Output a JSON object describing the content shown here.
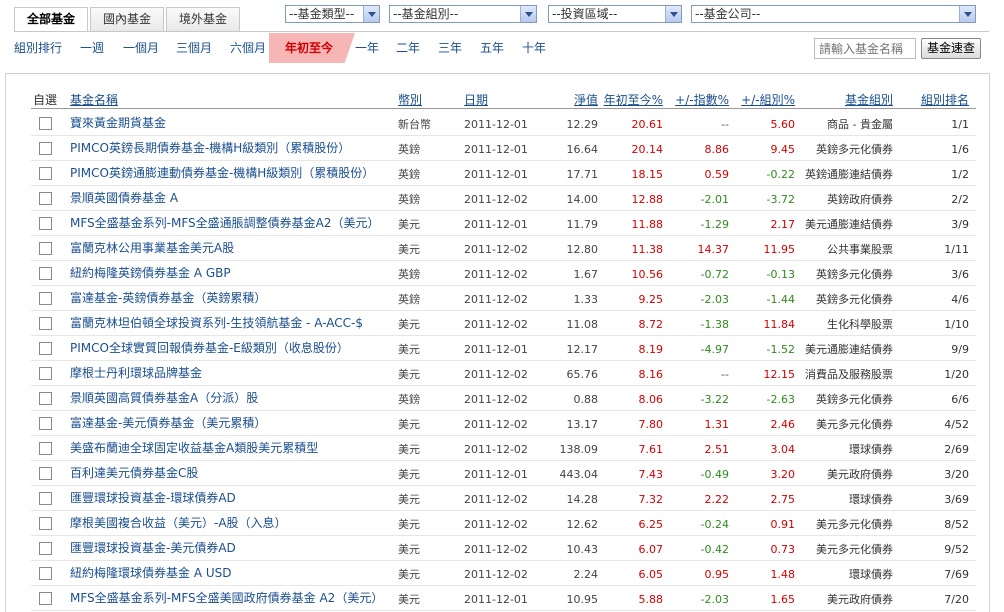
{
  "tabs": [
    "全部基金",
    "國內基金",
    "境外基金"
  ],
  "selects": {
    "type": "--基金類型--",
    "group": "--基金組別--",
    "region": "--投資區域--",
    "company": "--基金公司--"
  },
  "periods": [
    "組別排行",
    "一週",
    "一個月",
    "三個月",
    "六個月",
    "年初至今",
    "一年",
    "二年",
    "三年",
    "五年",
    "十年"
  ],
  "active_period": "年初至今",
  "search": {
    "placeholder": "請輸入基金名稱",
    "button": "基金速查"
  },
  "table": {
    "headers": {
      "select": "自選",
      "name": "基金名稱",
      "currency": "幣別",
      "date": "日期",
      "nav": "淨值",
      "ytd": "年初至今%",
      "vs_index": "+/-指數%",
      "vs_group": "+/-組別%",
      "group": "基金組別",
      "rank": "組別排名"
    },
    "rows": [
      {
        "name": "寶來黃金期貨基金",
        "currency": "新台幣",
        "date": "2011-12-01",
        "nav": "12.29",
        "ytd": "20.61",
        "idx": "--",
        "grp": "5.60",
        "group": "商品 - 貴金屬",
        "rank": "1/1"
      },
      {
        "name": "PIMCO英鎊長期債券基金-機構H級類別（累積股份）",
        "currency": "英鎊",
        "date": "2011-12-01",
        "nav": "16.64",
        "ytd": "20.14",
        "idx": "8.86",
        "grp": "9.45",
        "group": "英鎊多元化債券",
        "rank": "1/6"
      },
      {
        "name": "PIMCO英鎊通膨連動債券基金-機構H級類別（累積股份）",
        "currency": "英鎊",
        "date": "2011-12-01",
        "nav": "17.71",
        "ytd": "18.15",
        "idx": "0.59",
        "grp": "-0.22",
        "group": "英鎊通膨連結債券",
        "rank": "1/2"
      },
      {
        "name": "景順英國債券基金 A",
        "currency": "英鎊",
        "date": "2011-12-02",
        "nav": "14.00",
        "ytd": "12.88",
        "idx": "-2.01",
        "grp": "-3.72",
        "group": "英鎊政府債券",
        "rank": "2/2"
      },
      {
        "name": "MFS全盛基金系列-MFS全盛通脹調整債券基金A2（美元）",
        "currency": "美元",
        "date": "2011-12-01",
        "nav": "11.79",
        "ytd": "11.88",
        "idx": "-1.29",
        "grp": "2.17",
        "group": "美元通膨連結債券",
        "rank": "3/9"
      },
      {
        "name": "富蘭克林公用事業基金美元A股",
        "currency": "美元",
        "date": "2011-12-02",
        "nav": "12.80",
        "ytd": "11.38",
        "idx": "14.37",
        "grp": "11.95",
        "group": "公共事業股票",
        "rank": "1/11"
      },
      {
        "name": "紐約梅隆英鎊債券基金 A GBP",
        "currency": "英鎊",
        "date": "2011-12-02",
        "nav": "1.67",
        "ytd": "10.56",
        "idx": "-0.72",
        "grp": "-0.13",
        "group": "英鎊多元化債券",
        "rank": "3/6"
      },
      {
        "name": "富達基金-英鎊債券基金（英鎊累積）",
        "currency": "英鎊",
        "date": "2011-12-02",
        "nav": "1.33",
        "ytd": "9.25",
        "idx": "-2.03",
        "grp": "-1.44",
        "group": "英鎊多元化債券",
        "rank": "4/6"
      },
      {
        "name": "富蘭克林坦伯頓全球投資系列-生技領航基金 - A-ACC-$",
        "currency": "美元",
        "date": "2011-12-02",
        "nav": "11.08",
        "ytd": "8.72",
        "idx": "-1.38",
        "grp": "11.84",
        "group": "生化科學股票",
        "rank": "1/10"
      },
      {
        "name": "PIMCO全球實質回報債券基金-E級類別（收息股份）",
        "currency": "美元",
        "date": "2011-12-01",
        "nav": "12.17",
        "ytd": "8.19",
        "idx": "-4.97",
        "grp": "-1.52",
        "group": "美元通膨連結債券",
        "rank": "9/9"
      },
      {
        "name": "摩根士丹利環球品牌基金",
        "currency": "美元",
        "date": "2011-12-02",
        "nav": "65.76",
        "ytd": "8.16",
        "idx": "--",
        "grp": "12.15",
        "group": "消費品及服務股票",
        "rank": "1/20"
      },
      {
        "name": "景順英國高質債券基金A（分派）股",
        "currency": "英鎊",
        "date": "2011-12-02",
        "nav": "0.88",
        "ytd": "8.06",
        "idx": "-3.22",
        "grp": "-2.63",
        "group": "英鎊多元化債券",
        "rank": "6/6"
      },
      {
        "name": "富達基金-美元債券基金（美元累積）",
        "currency": "美元",
        "date": "2011-12-02",
        "nav": "13.17",
        "ytd": "7.80",
        "idx": "1.31",
        "grp": "2.46",
        "group": "美元多元化債券",
        "rank": "4/52"
      },
      {
        "name": "美盛布蘭迪全球固定收益基金A類股美元累積型",
        "currency": "美元",
        "date": "2011-12-02",
        "nav": "138.09",
        "ytd": "7.61",
        "idx": "2.51",
        "grp": "3.04",
        "group": "環球債券",
        "rank": "2/69"
      },
      {
        "name": "百利達美元債券基金C股",
        "currency": "美元",
        "date": "2011-12-01",
        "nav": "443.04",
        "ytd": "7.43",
        "idx": "-0.49",
        "grp": "3.20",
        "group": "美元政府債券",
        "rank": "3/20"
      },
      {
        "name": "匯豐環球投資基金-環球債券AD",
        "currency": "美元",
        "date": "2011-12-02",
        "nav": "14.28",
        "ytd": "7.32",
        "idx": "2.22",
        "grp": "2.75",
        "group": "環球債券",
        "rank": "3/69"
      },
      {
        "name": "摩根美國複合收益（美元）-A股（入息）",
        "currency": "美元",
        "date": "2011-12-02",
        "nav": "12.62",
        "ytd": "6.25",
        "idx": "-0.24",
        "grp": "0.91",
        "group": "美元多元化債券",
        "rank": "8/52"
      },
      {
        "name": "匯豐環球投資基金-美元債券AD",
        "currency": "美元",
        "date": "2011-12-02",
        "nav": "10.43",
        "ytd": "6.07",
        "idx": "-0.42",
        "grp": "0.73",
        "group": "美元多元化債券",
        "rank": "9/52"
      },
      {
        "name": "紐約梅隆環球債券基金 A USD",
        "currency": "美元",
        "date": "2011-12-02",
        "nav": "2.24",
        "ytd": "6.05",
        "idx": "0.95",
        "grp": "1.48",
        "group": "環球債券",
        "rank": "7/69"
      },
      {
        "name": "MFS全盛基金系列-MFS全盛美國政府債券基金 A2（美元）",
        "currency": "美元",
        "date": "2011-12-01",
        "nav": "10.95",
        "ytd": "5.88",
        "idx": "-2.03",
        "grp": "1.65",
        "group": "美元政府債券",
        "rank": "7/20"
      }
    ]
  },
  "colors": {
    "positive": "#d40000",
    "negative": "#2e8b1e",
    "link": "#1a4f8f",
    "active_period_bg": "#f7b6b6"
  }
}
